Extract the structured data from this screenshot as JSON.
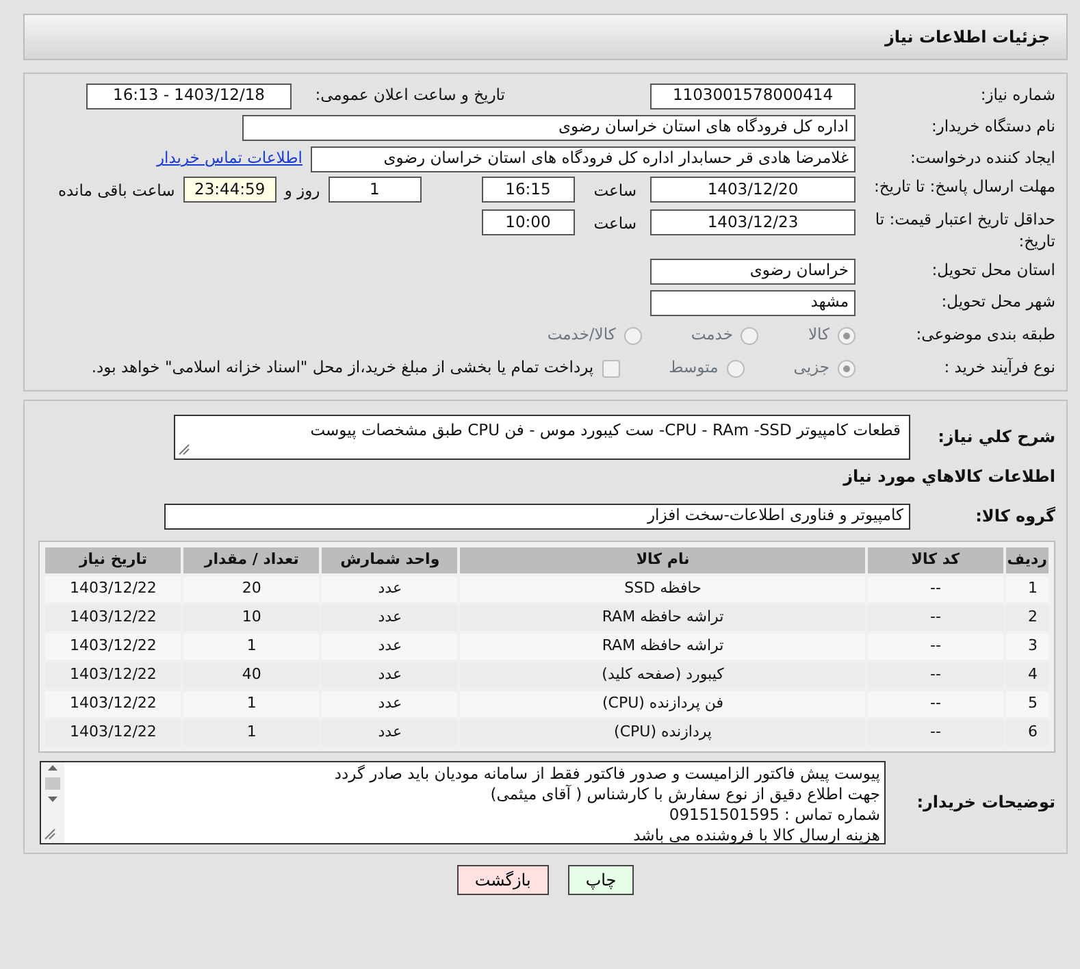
{
  "header": {
    "title": "جزئیات اطلاعات نیاز"
  },
  "need_number": {
    "label": "شماره نیاز:",
    "value": "1103001578000414"
  },
  "announce": {
    "label": "تاریخ و ساعت اعلان عمومی:",
    "value": "1403/12/18 - 16:13"
  },
  "buyer_org": {
    "label": "نام دستگاه خریدار:",
    "value": "اداره کل فرودگاه های استان خراسان رضوی"
  },
  "requester": {
    "label": "ایجاد کننده درخواست:",
    "value": "غلامرضا هادی قر حسابدار اداره کل فرودگاه های استان خراسان رضوی",
    "link": "اطلاعات تماس خریدار"
  },
  "deadline": {
    "label": "مهلت ارسال پاسخ: تا تاریخ:",
    "date": "1403/12/20",
    "time_label": "ساعت",
    "time": "16:15",
    "days": "1",
    "days_label": "روز و",
    "remaining": "23:44:59",
    "remaining_label": "ساعت باقی مانده"
  },
  "validity": {
    "label": "حداقل تاریخ اعتبار قیمت: تا تاریخ:",
    "date": "1403/12/23",
    "time_label": "ساعت",
    "time": "10:00"
  },
  "province": {
    "label": "استان محل تحویل:",
    "value": "خراسان رضوی"
  },
  "city": {
    "label": "شهر محل تحویل:",
    "value": "مشهد"
  },
  "category": {
    "label": "طبقه بندی موضوعی:",
    "options": [
      {
        "label": "کالا",
        "selected": true
      },
      {
        "label": "خدمت",
        "selected": false
      },
      {
        "label": "کالا/خدمت",
        "selected": false
      }
    ]
  },
  "process": {
    "label": "نوع فرآیند خرید :",
    "options": [
      {
        "label": "جزیی",
        "selected": true
      },
      {
        "label": "متوسط",
        "selected": false
      }
    ],
    "payment": {
      "label": "پرداخت تمام یا بخشی از مبلغ خرید،از محل \"اسناد خزانه اسلامی\" خواهد بود.",
      "checked": false
    }
  },
  "description": {
    "label": "شرح کلي نياز:",
    "value": "قطعات کامپیوتر  CPU - RAm -SSD-  ست کیبورد موس -  فن CPU  طبق مشخصات پیوست"
  },
  "items_heading": "اطلاعات کالاهاي مورد نياز",
  "goods_group": {
    "label": "گروه کالا:",
    "value": "کامپیوتر و فناوری اطلاعات-سخت افزار"
  },
  "table": {
    "columns": [
      "ردیف",
      "کد کالا",
      "نام کالا",
      "واحد شمارش",
      "تعداد / مقدار",
      "تاریخ نیاز"
    ],
    "rows": [
      [
        "1",
        "--",
        "حافظه SSD",
        "عدد",
        "20",
        "1403/12/22"
      ],
      [
        "2",
        "--",
        "تراشه حافظه RAM",
        "عدد",
        "10",
        "1403/12/22"
      ],
      [
        "3",
        "--",
        "تراشه حافظه RAM",
        "عدد",
        "1",
        "1403/12/22"
      ],
      [
        "4",
        "--",
        "کیبورد (صفحه کلید)",
        "عدد",
        "40",
        "1403/12/22"
      ],
      [
        "5",
        "--",
        "فن پردازنده (CPU)",
        "عدد",
        "1",
        "1403/12/22"
      ],
      [
        "6",
        "--",
        "پردازنده (CPU)",
        "عدد",
        "1",
        "1403/12/22"
      ]
    ]
  },
  "buyer_notes": {
    "label": "توضیحات خریدار:",
    "lines": [
      "پیوست پیش فاکتور الزامیست و صدور فاکتور فقط از سامانه مودیان باید صادر گردد",
      "جهت اطلاع دقیق از نوع سفارش با کارشناس  ( آقای میثمی)",
      "شماره تماس : 09151501595",
      "هزینه ارسال کالا با فروشنده می باشد"
    ]
  },
  "buttons": [
    {
      "label": "چاپ",
      "kind": "print"
    },
    {
      "label": "بازگشت",
      "kind": "back"
    }
  ]
}
